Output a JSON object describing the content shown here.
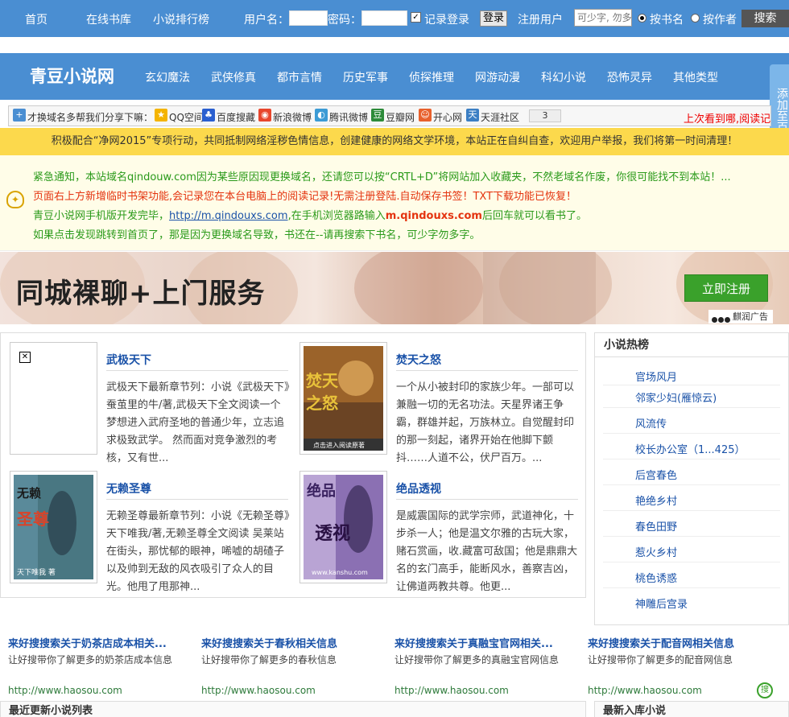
{
  "topbar": {
    "nav": [
      "首页",
      "在线书库",
      "小说排行榜"
    ],
    "username_label": "用户名：",
    "password_label": "密码：",
    "remember_label": "记录登录",
    "login_button": "登录",
    "register_link": "注册用户",
    "search_placeholder": "可少字, 勿多",
    "by_name_label": "按书名",
    "by_author_label": "按作者",
    "search_button": "搜索"
  },
  "mainnav": {
    "logo": "青豆小说网",
    "categories": [
      "玄幻魔法",
      "武侠修真",
      "都市言情",
      "历史军事",
      "侦探推理",
      "网游动漫",
      "科幻小说",
      "恐怖灵异",
      "其他类型"
    ]
  },
  "side_tab": "添加至百度新首页",
  "sharebar": {
    "intro": "才换域名多帮我们分享下嘛：",
    "items": [
      "QQ空间",
      "百度搜藏",
      "新浪微博",
      "腾讯微博",
      "豆瓣网",
      "开心网",
      "天涯社区"
    ],
    "count": "3",
    "last_read": "上次看到哪,阅读记"
  },
  "yellow_notice": "积极配合“净网2015”专项行动，共同抵制网络淫秽色情信息，创建健康的网络文学环境，本站正在自纠自查，欢迎用户举报，我们将第一时间清理！",
  "notice": {
    "line1": "紧急通知，本站域名qindouw.com因为某些原因现更换域名，还请您可以按“CRTL+D”将网站加入收藏夹，不然老域名作废，你很可能找不到本站！...",
    "line2": "页面右上方新增临时书架功能,会记录您在本台电脑上的阅读记录!无需注册登陆.自动保存书签！TXT下载功能已恢复！",
    "line3_pre": "青豆小说网手机版开发完毕，",
    "line3_link": "http://m.qindouxs.com",
    "line3_mid": ",在手机浏览器路输入",
    "line3_bold": "m.qindouxs.com",
    "line3_post": "后回车就可以看书了。",
    "line4": "如果点击发现跳转到首页了，那是因为更换域名导致，书还在--请再搜索下书名，可少字勿多字。"
  },
  "banner": {
    "text": "同城裸聊+上门服务",
    "button": "立即注册",
    "ad_flag": "麒润广告"
  },
  "featured": [
    {
      "title": "武极天下",
      "desc": "武极天下最新章节列：小说《武极天下》蚕茧里的牛/著,武极天下全文阅读一个梦想进入武府圣地的普通少年，立志追求极致武学。 然而面对竞争激烈的考核，又有世..."
    },
    {
      "title": "焚天之怒",
      "desc": "一个从小被封印的家族少年。一部可以兼融一切的无名功法。天星界诸王争霸，群雄并起，万族林立。自觉醒封印的那一刻起，诸界开始在他脚下颤抖……人道不公，伏尸百万。..."
    },
    {
      "title": "无赖圣尊",
      "desc": "无赖圣尊最新章节列：小说《无赖圣尊》天下唯我/著,无赖圣尊全文阅读 吴莱站在街头，那忧郁的眼神，唏嘘的胡碴子以及帅到无敌的风衣吸引了众人的目光。他甩了甩那神..."
    },
    {
      "title": "绝品透视",
      "desc": "是威震国际的武学宗师，武道神化，十步杀一人；他是温文尔雅的古玩大家，赌石赏画，收.藏富可敌国；他是鼎鼎大名的玄门高手，能断风水，善察吉凶，让佛道两教共尊。他更..."
    }
  ],
  "covers": {
    "fentian": {
      "line1": "焚天",
      "line2": "之怒",
      "sub": "点击进入阅读原著",
      "color": "#c47a2a"
    },
    "wulai": {
      "line1": "无赖",
      "line2": "圣尊",
      "sub": "天下唯我 著",
      "color": "#d8442a"
    },
    "juepin": {
      "line1": "绝品",
      "line2": "透视",
      "sub": "www.kanshu.com",
      "color": "#3a2260"
    }
  },
  "hot": {
    "header": "小说热榜",
    "items": [
      "官场风月",
      "邻家少妇(雁惊云)",
      "风流传",
      "校长办公室（1...425）",
      "后宫春色",
      "艳绝乡村",
      "春色田野",
      "惹火乡村",
      "桃色诱惑",
      "神雕后宫录"
    ]
  },
  "adlinks": [
    {
      "title": "来好搜搜索关于奶茶店成本相关...",
      "desc": "让好搜带你了解更多的奶茶店成本信息",
      "url": "http://www.haosou.com"
    },
    {
      "title": "来好搜搜索关于春秋相关信息",
      "desc": "让好搜带你了解更多的春秋信息",
      "url": "http://www.haosou.com"
    },
    {
      "title": "来好搜搜索关于真融宝官网相关...",
      "desc": "让好搜带你了解更多的真融宝官网信息",
      "url": "http://www.haosou.com"
    },
    {
      "title": "来好搜搜索关于配音网相关信息",
      "desc": "让好搜带你了解更多的配音网信息",
      "url": "http://www.haosou.com"
    }
  ],
  "adlogo": "搜",
  "bottom": {
    "recent_updates": "最近更新小说列表",
    "new_entries": "最新入库小说"
  }
}
